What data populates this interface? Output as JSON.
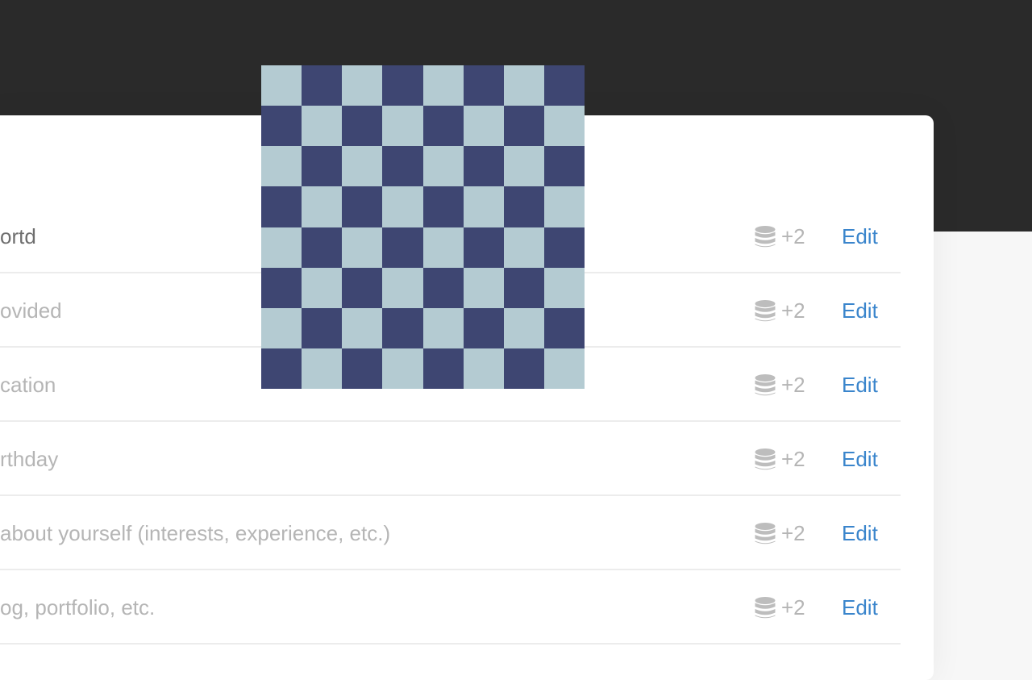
{
  "colors": {
    "accent": "#3a85cc",
    "checker_light": "#b4cbd2",
    "checker_dark": "#3e4672"
  },
  "rows": [
    {
      "label": "ortd",
      "filled": true,
      "count": "+2",
      "action": "Edit"
    },
    {
      "label": "ovided",
      "filled": false,
      "count": "+2",
      "action": "Edit"
    },
    {
      "label": "cation",
      "filled": false,
      "count": "+2",
      "action": "Edit"
    },
    {
      "label": "rthday",
      "filled": false,
      "count": "+2",
      "action": "Edit"
    },
    {
      "label": "about yourself (interests, experience, etc.)",
      "filled": false,
      "count": "+2",
      "action": "Edit"
    },
    {
      "label": "og, portfolio, etc.",
      "filled": false,
      "count": "+2",
      "action": "Edit"
    }
  ],
  "icons": {
    "row_icon": "database-icon"
  }
}
